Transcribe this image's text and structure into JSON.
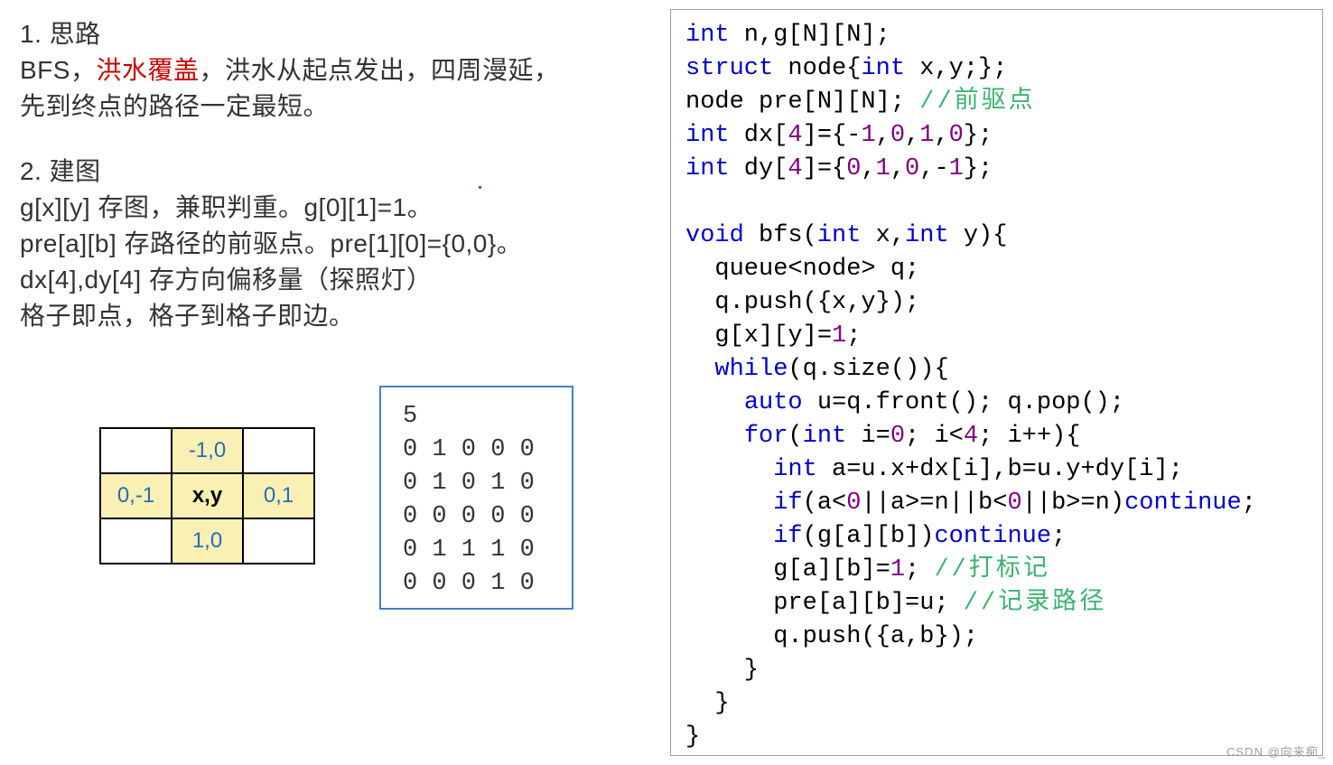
{
  "left": {
    "h1": "1. 思路",
    "l1a": "BFS，",
    "l1red": "洪水覆盖",
    "l1b": "，洪水从起点发出，四周漫延，",
    "l2": "先到终点的路径一定最短。",
    "h2": "2. 建图",
    "l3": "g[x][y] 存图，兼职判重。g[0][1]=1。",
    "l4": "pre[a][b] 存路径的前驱点。pre[1][0]={0,0}。",
    "l5": "dx[4],dy[4] 存方向偏移量（探照灯）",
    "l6": "格子即点，格子到格子即边。"
  },
  "grid": {
    "up": "-1,0",
    "left": "0,-1",
    "center": "x,y",
    "right": "0,1",
    "down": "1,0"
  },
  "maze": "5\n0 1 0 0 0\n0 1 0 1 0\n0 0 0 0 0\n0 1 1 1 0\n0 0 0 1 0",
  "code": {
    "c1a": "int",
    "c1b": " n,g[N][N];",
    "c2a": "struct",
    "c2b": " node{",
    "c2c": "int",
    "c2d": " x,y;};",
    "c3a": "node pre[N][N]; ",
    "c3b": "//前驱点",
    "c4a": "int",
    "c4b": " dx[",
    "c4c": "4",
    "c4d": "]={-",
    "c4e": "1",
    "c4f": ",",
    "c4g": "0",
    "c4h": ",",
    "c4i": "1",
    "c4j": ",",
    "c4k": "0",
    "c4l": "};",
    "c5a": "int",
    "c5b": " dy[",
    "c5c": "4",
    "c5d": "]={",
    "c5e": "0",
    "c5f": ",",
    "c5g": "1",
    "c5h": ",",
    "c5i": "0",
    "c5j": ",-",
    "c5k": "1",
    "c5l": "};",
    "c6": "",
    "c7a": "void",
    "c7b": " bfs(",
    "c7c": "int",
    "c7d": " x,",
    "c7e": "int",
    "c7f": " y){",
    "c8": "  queue<node> q;",
    "c9": "  q.push({x,y});",
    "c10a": "  g[x][y]=",
    "c10b": "1",
    "c10c": ";",
    "c11a": "  ",
    "c11b": "while",
    "c11c": "(q.size()){",
    "c12a": "    ",
    "c12b": "auto",
    "c12c": " u=q.front(); q.pop();",
    "c13a": "    ",
    "c13b": "for",
    "c13c": "(",
    "c13d": "int",
    "c13e": " i=",
    "c13f": "0",
    "c13g": "; i<",
    "c13h": "4",
    "c13i": "; i++){",
    "c14a": "      ",
    "c14b": "int",
    "c14c": " a=u.x+dx[i],b=u.y+dy[i];",
    "c15a": "      ",
    "c15b": "if",
    "c15c": "(a<",
    "c15d": "0",
    "c15e": "||a>=n||b<",
    "c15f": "0",
    "c15g": "||b>=n)",
    "c15h": "continue",
    "c15i": ";",
    "c16a": "      ",
    "c16b": "if",
    "c16c": "(g[a][b])",
    "c16d": "continue",
    "c16e": ";",
    "c17a": "      g[a][b]=",
    "c17b": "1",
    "c17c": "; ",
    "c17d": "//打标记",
    "c18a": "      pre[a][b]=u; ",
    "c18b": "//记录路径",
    "c19": "      q.push({a,b});",
    "c20": "    }",
    "c21": "  }",
    "c22": "}"
  },
  "watermark": "CSDN @向来痴_"
}
